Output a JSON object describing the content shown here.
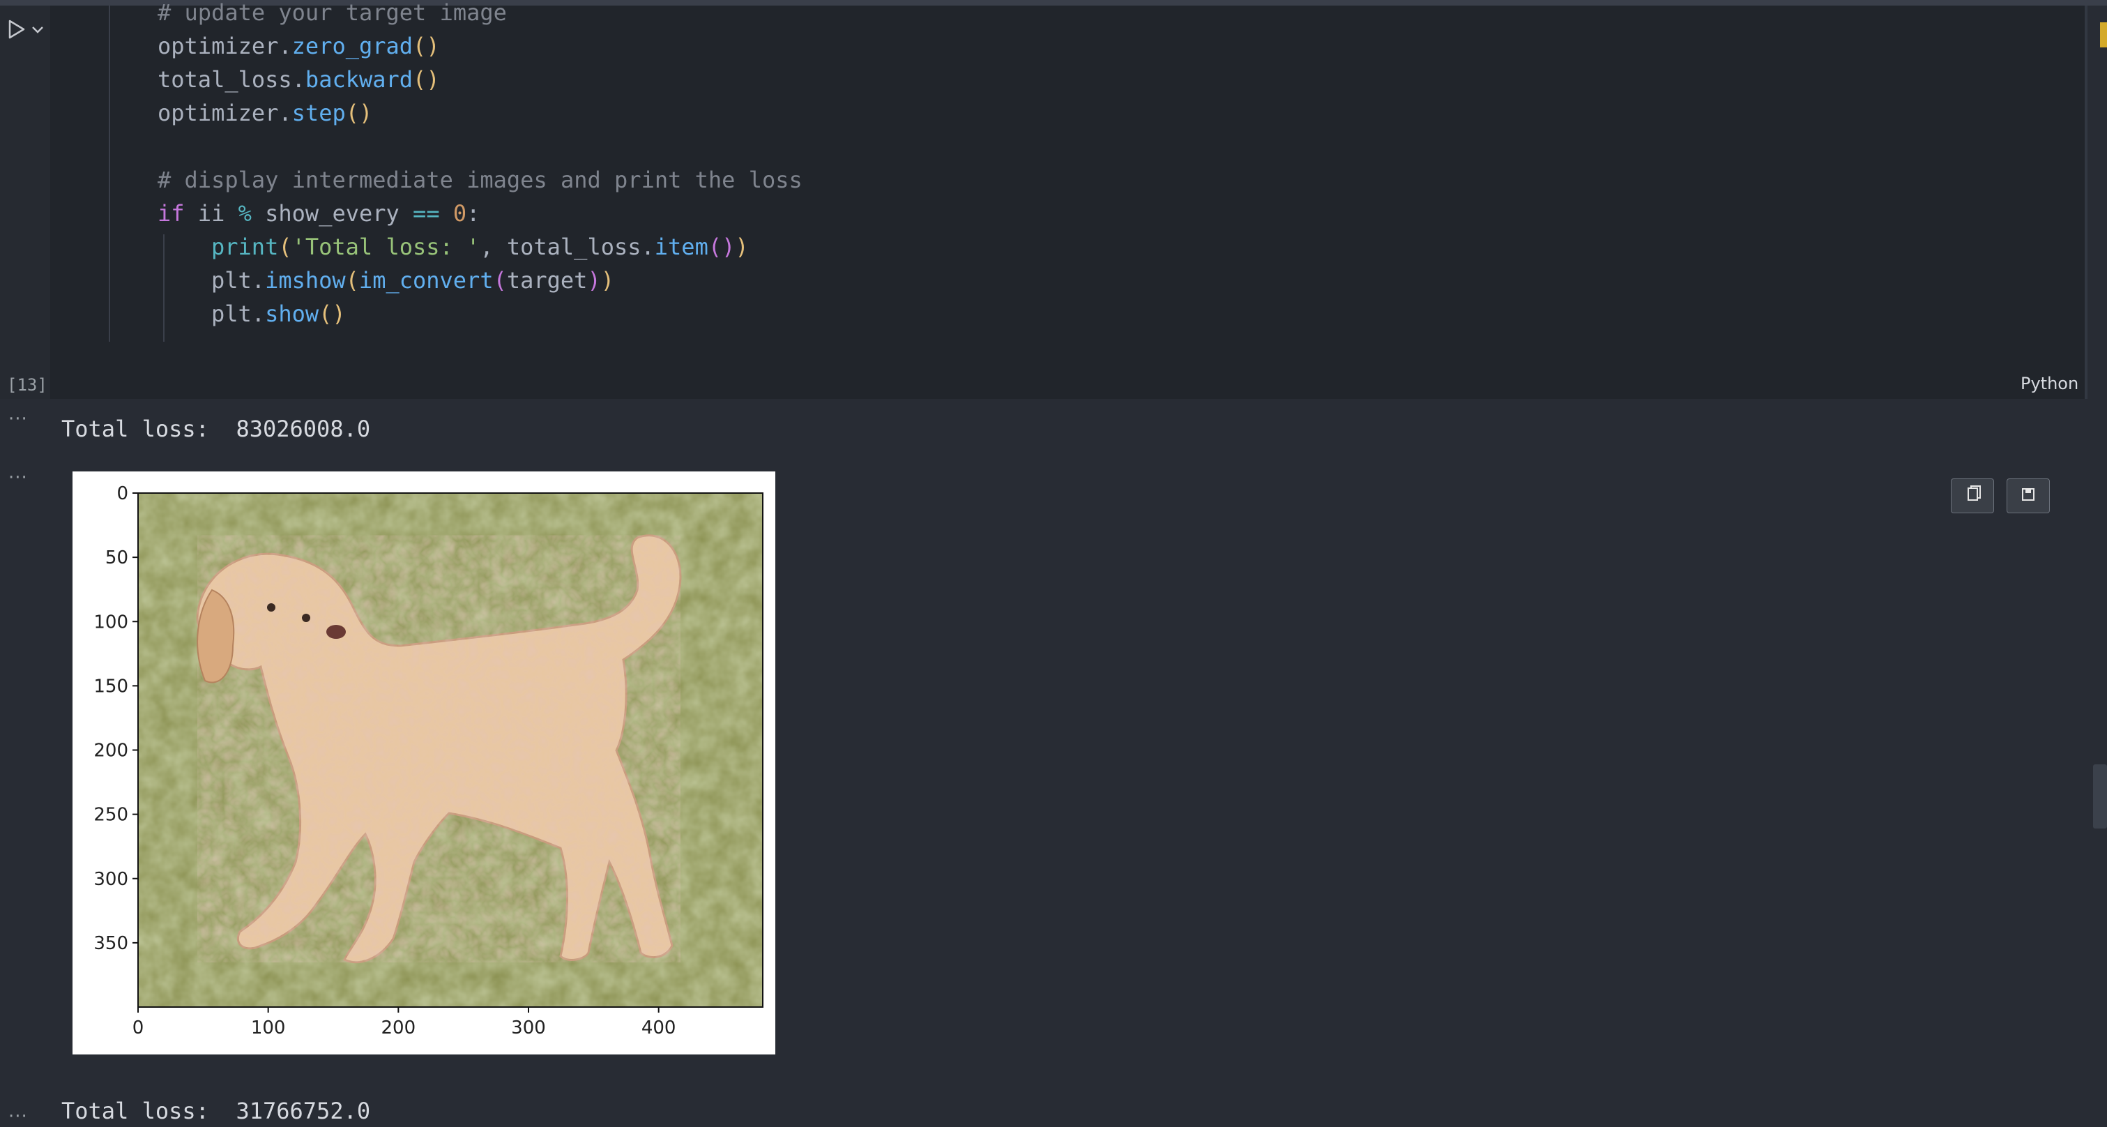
{
  "cell": {
    "code_lines": [
      {
        "indent": 1,
        "tokens": [
          {
            "t": "# update your target image",
            "c": "cmt"
          }
        ]
      },
      {
        "indent": 1,
        "tokens": [
          {
            "t": "optimizer.",
            "c": ""
          },
          {
            "t": "zero_grad",
            "c": "fn"
          },
          {
            "t": "()",
            "c": "p1"
          }
        ]
      },
      {
        "indent": 1,
        "tokens": [
          {
            "t": "total_loss.",
            "c": ""
          },
          {
            "t": "backward",
            "c": "fn"
          },
          {
            "t": "()",
            "c": "p1"
          }
        ]
      },
      {
        "indent": 1,
        "tokens": [
          {
            "t": "optimizer.",
            "c": ""
          },
          {
            "t": "step",
            "c": "fn"
          },
          {
            "t": "()",
            "c": "p1"
          }
        ]
      },
      {
        "indent": 1,
        "tokens": []
      },
      {
        "indent": 1,
        "tokens": [
          {
            "t": "# display intermediate images and print the loss",
            "c": "cmt"
          }
        ]
      },
      {
        "indent": 1,
        "tokens": [
          {
            "t": "if",
            "c": "kw"
          },
          {
            "t": " ii ",
            "c": ""
          },
          {
            "t": "%",
            "c": "op"
          },
          {
            "t": " show_every ",
            "c": ""
          },
          {
            "t": "==",
            "c": "op"
          },
          {
            "t": " ",
            "c": ""
          },
          {
            "t": "0",
            "c": "num"
          },
          {
            "t": ":",
            "c": ""
          }
        ]
      },
      {
        "indent": 2,
        "tokens": [
          {
            "t": "print",
            "c": "call"
          },
          {
            "t": "(",
            "c": "p1"
          },
          {
            "t": "'Total loss: '",
            "c": "str"
          },
          {
            "t": ", total_loss.",
            "c": ""
          },
          {
            "t": "item",
            "c": "fn"
          },
          {
            "t": "()",
            "c": "p2"
          },
          {
            "t": ")",
            "c": "p1"
          }
        ]
      },
      {
        "indent": 2,
        "tokens": [
          {
            "t": "plt.",
            "c": ""
          },
          {
            "t": "imshow",
            "c": "fn"
          },
          {
            "t": "(",
            "c": "p1"
          },
          {
            "t": "im_convert",
            "c": "fn"
          },
          {
            "t": "(",
            "c": "p2"
          },
          {
            "t": "target",
            "c": ""
          },
          {
            "t": ")",
            "c": "p2"
          },
          {
            "t": ")",
            "c": "p1"
          }
        ]
      },
      {
        "indent": 2,
        "tokens": [
          {
            "t": "plt.",
            "c": ""
          },
          {
            "t": "show",
            "c": "fn"
          },
          {
            "t": "()",
            "c": "p1"
          }
        ]
      }
    ],
    "execution_count": "[13]",
    "language": "Python",
    "run_icon": "play-icon",
    "run_menu_icon": "chevron-down-icon"
  },
  "outputs": {
    "more_icon": "ellipsis-icon",
    "more_label": "···",
    "loss_line_1": "Total loss:  83026008.0",
    "loss_line_2": "Total loss:  31766752.0",
    "image": {
      "description_icon": "dog-image",
      "x_ticks": [
        "0",
        "100",
        "200",
        "300",
        "400"
      ],
      "y_ticks": [
        "0",
        "50",
        "100",
        "150",
        "200",
        "250",
        "300",
        "350"
      ],
      "x_range": [
        0,
        480
      ],
      "y_range": [
        0,
        400
      ],
      "x_tick_values": [
        0,
        100,
        200,
        300,
        400
      ],
      "y_tick_values": [
        0,
        50,
        100,
        150,
        200,
        250,
        300,
        350
      ]
    },
    "copy_icon": "copy-icon",
    "save_icon": "save-icon"
  }
}
